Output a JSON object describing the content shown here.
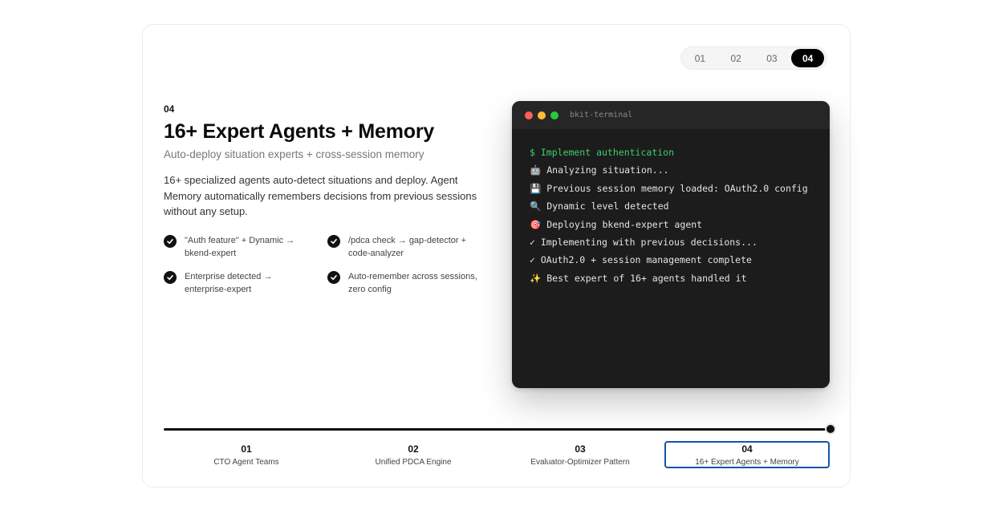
{
  "pager": [
    "01",
    "02",
    "03",
    "04"
  ],
  "active_pager": "04",
  "step": {
    "number": "04",
    "title": "16+ Expert Agents + Memory",
    "subtitle": "Auto-deploy situation experts + cross-session memory",
    "description": "16+ specialized agents auto-detect situations and deploy. Agent Memory automatically remembers decisions from previous sessions without any setup."
  },
  "features": [
    "\"Auth feature\" + Dynamic → bkend-expert",
    "/pdca check → gap-detector + code-analyzer",
    "Enterprise detected → enterprise-expert",
    "Auto-remember across sessions, zero config"
  ],
  "terminal": {
    "title": "bkit-terminal",
    "lines": [
      "$ Implement authentication",
      "🤖 Analyzing situation...",
      "💾 Previous session memory loaded: OAuth2.0 config",
      "🔍 Dynamic level detected",
      "🎯 Deploying bkend-expert agent",
      "✓ Implementing with previous decisions...",
      "✓ OAuth2.0 + session management complete",
      "✨ Best expert of 16+ agents handled it"
    ]
  },
  "progress": {
    "value": 1.0
  },
  "timeline": [
    {
      "num": "01",
      "label": "CTO Agent Teams"
    },
    {
      "num": "02",
      "label": "Unified PDCA Engine"
    },
    {
      "num": "03",
      "label": "Evaluator-Optimizer Pattern"
    },
    {
      "num": "04",
      "label": "16+ Expert Agents + Memory"
    }
  ],
  "colors": {
    "accent": "#1553a8",
    "command_green": "#3ecf6a",
    "terminal_bg": "#1c1c1c",
    "dot_red": "#ff5f57",
    "dot_yellow": "#febc2e",
    "dot_green": "#28c840"
  },
  "icons": [
    "check-icon"
  ]
}
